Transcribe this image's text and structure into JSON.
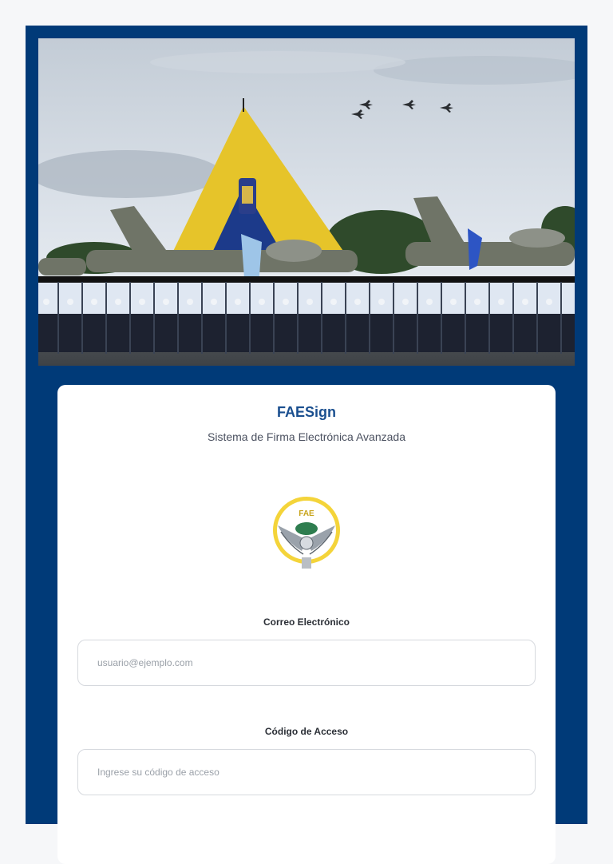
{
  "hero": {
    "image": "FAE military ceremony with cadets in formation, aircraft and flag tent"
  },
  "login": {
    "title": "FAESign",
    "subtitle": "Sistema de Firma Electrónica Avanzada",
    "emblem_text": "FAE",
    "email": {
      "label": "Correo Electrónico",
      "placeholder": "usuario@ejemplo.com",
      "value": ""
    },
    "code": {
      "label": "Código de Acceso",
      "placeholder": "Ingrese su código de acceso",
      "value": ""
    }
  },
  "colors": {
    "frame_bg": "#003a78",
    "title": "#1a4f8f",
    "card_bg": "#ffffff",
    "input_border": "#d6d9de"
  }
}
